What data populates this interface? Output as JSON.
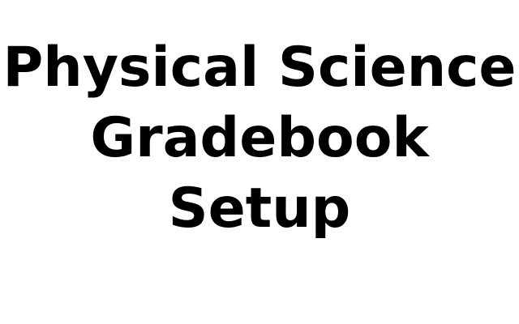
{
  "title": {
    "lines": [
      "Physical Science",
      "Gradebook",
      "Setup"
    ]
  },
  "colors": {
    "background": "#ffffff",
    "text": "#000000"
  }
}
